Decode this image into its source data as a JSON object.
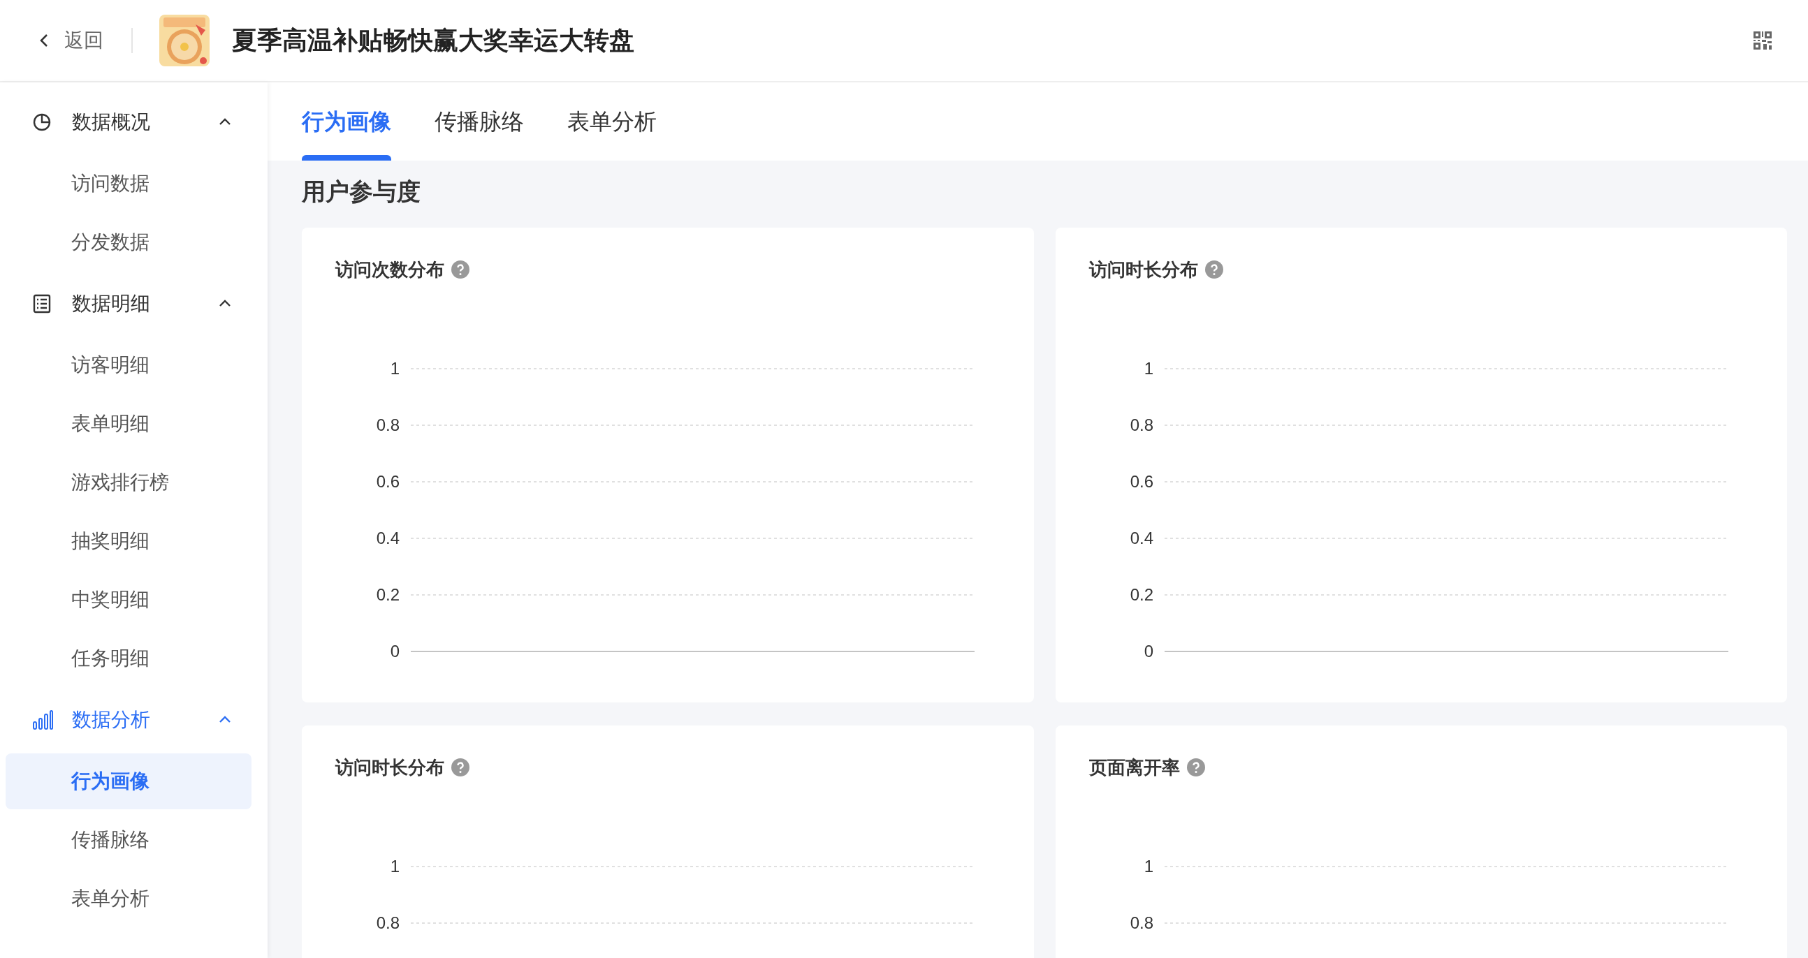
{
  "header": {
    "back": "返回",
    "title": "夏季高温补贴畅快赢大奖幸运大转盘"
  },
  "sidebar": [
    {
      "label": "数据概况",
      "kind": "pie",
      "expanded": true,
      "selected": false,
      "items": [
        {
          "label": "访问数据",
          "selected": false
        },
        {
          "label": "分发数据",
          "selected": false
        }
      ]
    },
    {
      "label": "数据明细",
      "kind": "list",
      "expanded": true,
      "selected": false,
      "items": [
        {
          "label": "访客明细",
          "selected": false
        },
        {
          "label": "表单明细",
          "selected": false
        },
        {
          "label": "游戏排行榜",
          "selected": false
        },
        {
          "label": "抽奖明细",
          "selected": false
        },
        {
          "label": "中奖明细",
          "selected": false
        },
        {
          "label": "任务明细",
          "selected": false
        }
      ]
    },
    {
      "label": "数据分析",
      "kind": "bars",
      "expanded": true,
      "selected": true,
      "items": [
        {
          "label": "行为画像",
          "selected": true
        },
        {
          "label": "传播脉络",
          "selected": false
        },
        {
          "label": "表单分析",
          "selected": false
        }
      ]
    }
  ],
  "tabs": [
    {
      "label": "行为画像",
      "selected": true
    },
    {
      "label": "传播脉络",
      "selected": false
    },
    {
      "label": "表单分析",
      "selected": false
    }
  ],
  "section_title": "用户参与度",
  "cards": [
    {
      "title": "访问次数分布",
      "y_axis_labels": [
        "1",
        "0.8",
        "0.6",
        "0.4",
        "0.2",
        "0"
      ]
    },
    {
      "title": "访问时长分布",
      "y_axis_labels": [
        "1",
        "0.8",
        "0.6",
        "0.4",
        "0.2",
        "0"
      ]
    },
    {
      "title": "访问时长分布",
      "y_axis_labels": [
        "1",
        "0.8"
      ]
    },
    {
      "title": "页面离开率",
      "y_axis_labels": [
        "1",
        "0.8"
      ]
    }
  ]
}
